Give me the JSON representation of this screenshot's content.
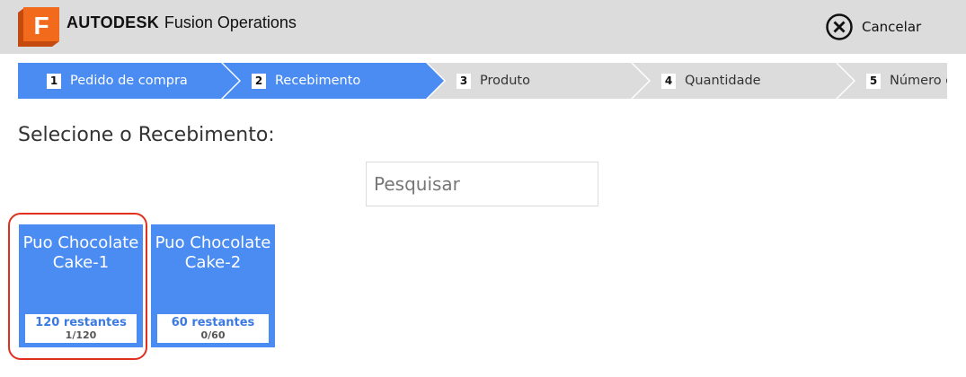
{
  "header": {
    "logo_letter": "F",
    "brand": "AUTODESK",
    "product": "Fusion Operations",
    "cancel_label": "Cancelar",
    "colors": {
      "logo_bg": "#f26b1d",
      "header_bg": "#dcdcdc"
    }
  },
  "steps": [
    {
      "num": "1",
      "label": "Pedido de compra",
      "state": "active"
    },
    {
      "num": "2",
      "label": "Recebimento",
      "state": "active"
    },
    {
      "num": "3",
      "label": "Produto",
      "state": "inactive"
    },
    {
      "num": "4",
      "label": "Quantidade",
      "state": "inactive"
    },
    {
      "num": "5",
      "label": "Número d",
      "state": "inactive"
    }
  ],
  "step_colors": {
    "active": "#4b8cf3",
    "inactive": "#dcdcdc"
  },
  "main": {
    "heading": "Selecione o Recebimento:",
    "search_placeholder": "Pesquisar",
    "cards": [
      {
        "title": "Puo Chocolate Cake-1",
        "remaining": "120 restantes",
        "count": "1/120",
        "selected": true
      },
      {
        "title": "Puo Chocolate Cake-2",
        "remaining": "60 restantes",
        "count": "0/60",
        "selected": false
      }
    ]
  }
}
